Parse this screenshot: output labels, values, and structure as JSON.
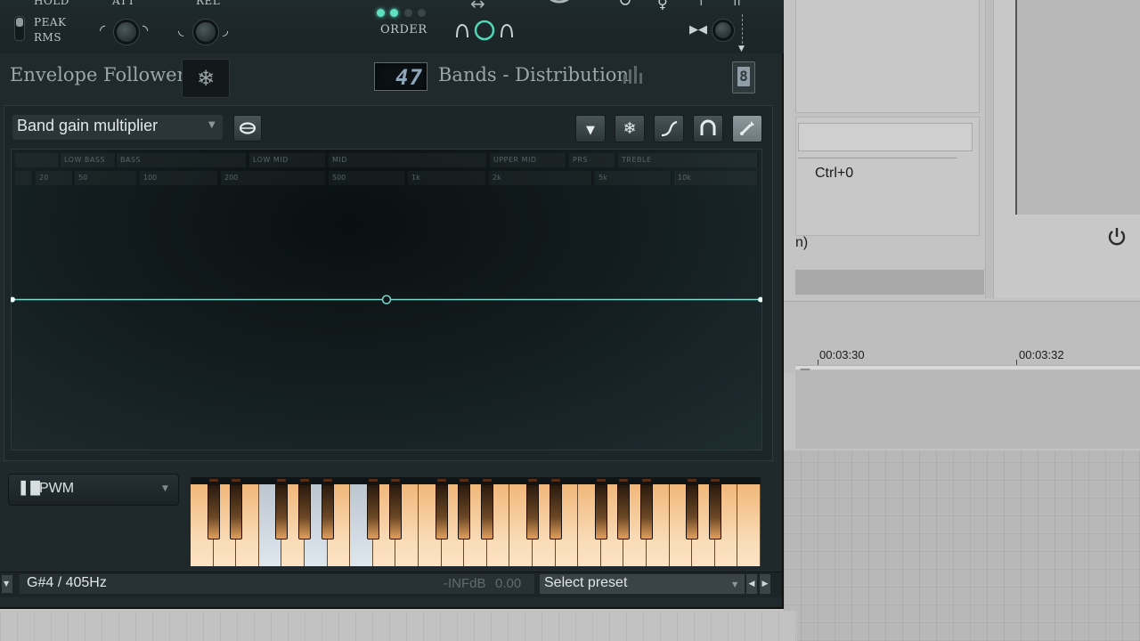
{
  "top_controls": {
    "hold_label": "HOLD",
    "peak_label": "PEAK",
    "rms_label": "RMS",
    "att_label": "ATT",
    "rel_label": "REL",
    "order_label": "ORDER"
  },
  "header": {
    "envelope_title": "Envelope Follower",
    "bands_value": "47",
    "bands_title": "Bands - Distribution",
    "ghost_digit": "8"
  },
  "graph": {
    "mode_select": "Band gain multiplier",
    "band_labels": [
      "LOW BASS",
      "BASS",
      "LOW MID",
      "MID",
      "UPPER MID",
      "PRS",
      "TREBLE"
    ],
    "freq_labels": [
      "20",
      "50",
      "100",
      "200",
      "500",
      "1k",
      "2k",
      "5k",
      "10k"
    ],
    "gain_level": 0.5
  },
  "keyboard": {
    "preset_name": "PWM"
  },
  "status": {
    "note": "G#4 / 405Hz",
    "level": "-INFdB",
    "value": "0.00",
    "preset_select": "Select preset"
  },
  "host": {
    "shortcut": "Ctrl+0",
    "paren_text": "n)",
    "time_1": "00:03:30",
    "time_2": "00:03:32"
  },
  "colors": {
    "accent_teal": "#7fd9cf",
    "panel_dark": "#20292c",
    "key_orange": "#f4b878",
    "host_gray": "#c6c6c6"
  }
}
